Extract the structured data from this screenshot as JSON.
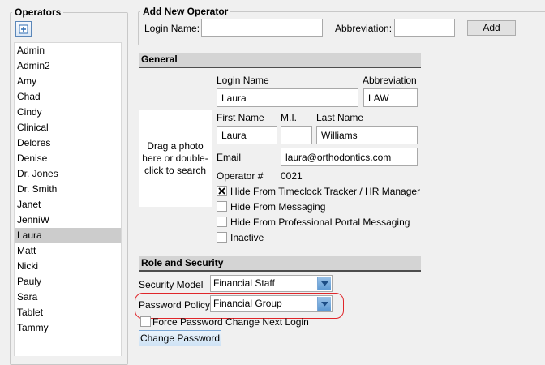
{
  "operators": {
    "legend": "Operators",
    "items": [
      "Admin",
      "Admin2",
      "Amy",
      "Chad",
      "Cindy",
      "Clinical",
      "Delores",
      "Denise",
      "Dr. Jones",
      "Dr. Smith",
      "Janet",
      "JenniW",
      "Laura",
      "Matt",
      "Nicki",
      "Pauly",
      "Sara",
      "Tablet",
      "Tammy"
    ],
    "selected_index": 12,
    "add_icon": "plus-icon"
  },
  "add_new": {
    "legend": "Add New Operator",
    "login_label": "Login Name:",
    "login_value": "",
    "abbr_label": "Abbreviation:",
    "abbr_value": "",
    "add_button": "Add"
  },
  "general": {
    "header": "General",
    "photo_text": "Drag a photo here or double-click to search",
    "login_name_label": "Login Name",
    "login_name_value": "Laura",
    "abbreviation_label": "Abbreviation",
    "abbreviation_value": "LAW",
    "first_name_label": "First Name",
    "first_name_value": "Laura",
    "mi_label": "M.I.",
    "mi_value": "",
    "last_name_label": "Last Name",
    "last_name_value": "Williams",
    "email_label": "Email",
    "email_value": "laura@orthodontics.com",
    "operator_num_label": "Operator #",
    "operator_num_value": "0021",
    "checkboxes": [
      {
        "label": "Hide From Timeclock Tracker / HR Manager",
        "checked": true
      },
      {
        "label": "Hide From Messaging",
        "checked": false
      },
      {
        "label": "Hide From Professional Portal Messaging",
        "checked": false
      },
      {
        "label": "Inactive",
        "checked": false
      }
    ]
  },
  "role": {
    "header": "Role and Security",
    "security_model_label": "Security Model",
    "security_model_value": "Financial Staff",
    "password_policy_label": "Password Policy",
    "password_policy_value": "Financial Group",
    "force_change_label": "Force Password Change Next Login",
    "force_change_checked": false,
    "change_password_button": "Change Password"
  },
  "colors": {
    "highlight": "#e0262a",
    "selected_row": "#cccccc",
    "combo_arrow": "#5d99d3"
  }
}
